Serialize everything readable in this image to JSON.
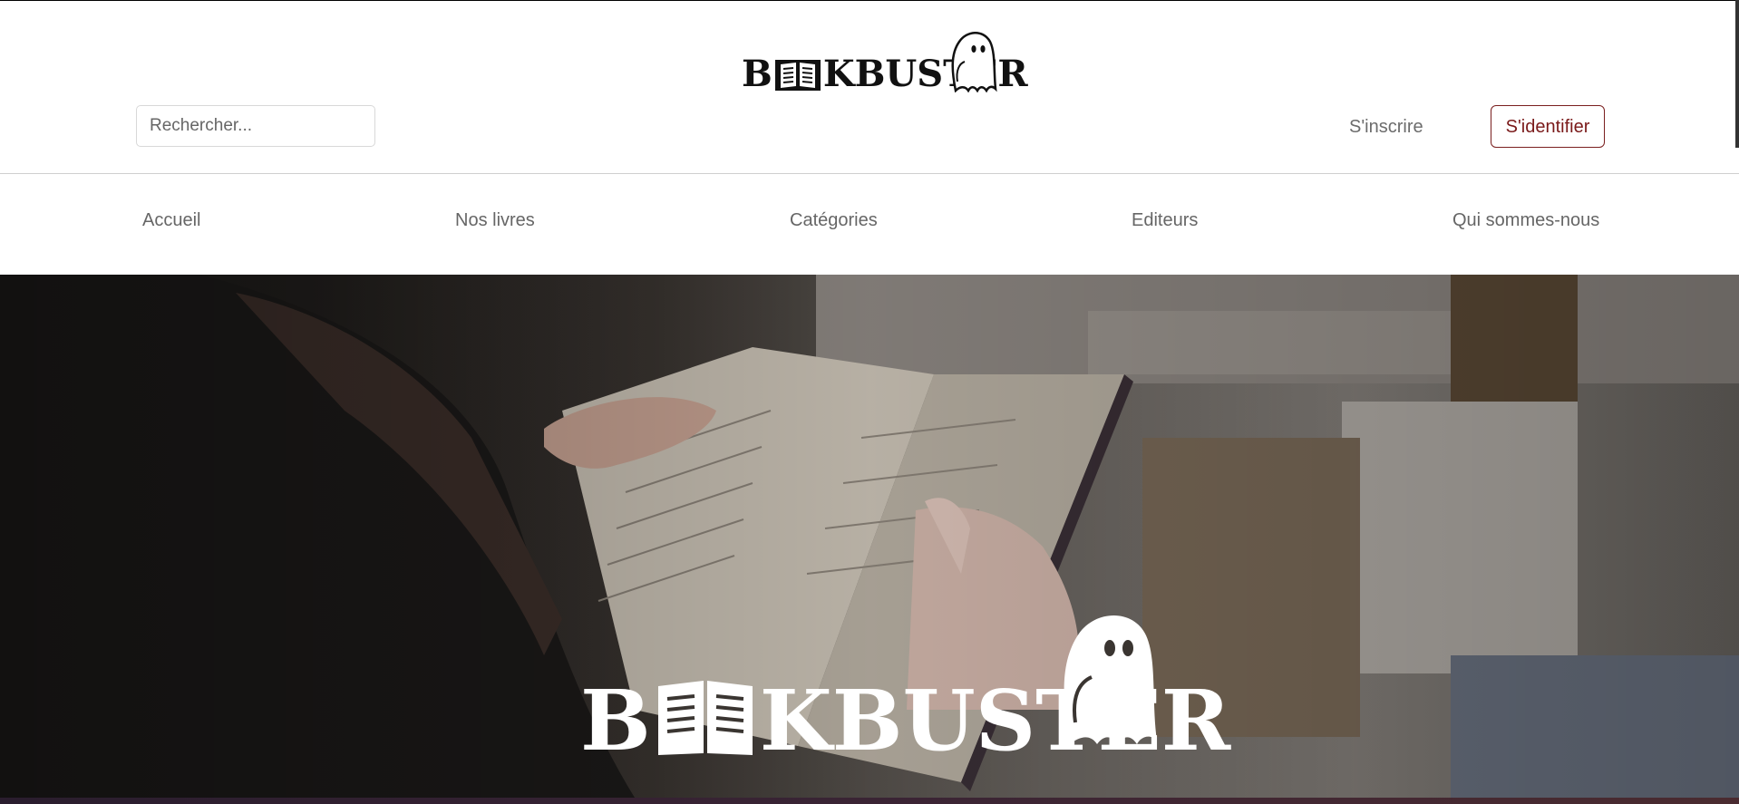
{
  "brand": {
    "logo_text_before": "B",
    "logo_text_after": "KBUSTER",
    "logo_icon": "open-book-icon",
    "mascot_icon": "ghost-icon"
  },
  "header": {
    "search_placeholder": "Rechercher...",
    "signup_label": "S'inscrire",
    "login_label": "S'identifier"
  },
  "nav": {
    "items": [
      {
        "label": "Accueil"
      },
      {
        "label": "Nos livres"
      },
      {
        "label": "Catégories"
      },
      {
        "label": "Editeurs"
      },
      {
        "label": "Qui sommes-nous"
      }
    ]
  },
  "hero": {
    "logo_text_before": "B",
    "logo_text_after": "KBUSTER"
  },
  "colors": {
    "accent": "#7a1a1a",
    "nav_text": "#666666",
    "logo_dark": "#111111",
    "hero_logo": "#ffffff"
  }
}
